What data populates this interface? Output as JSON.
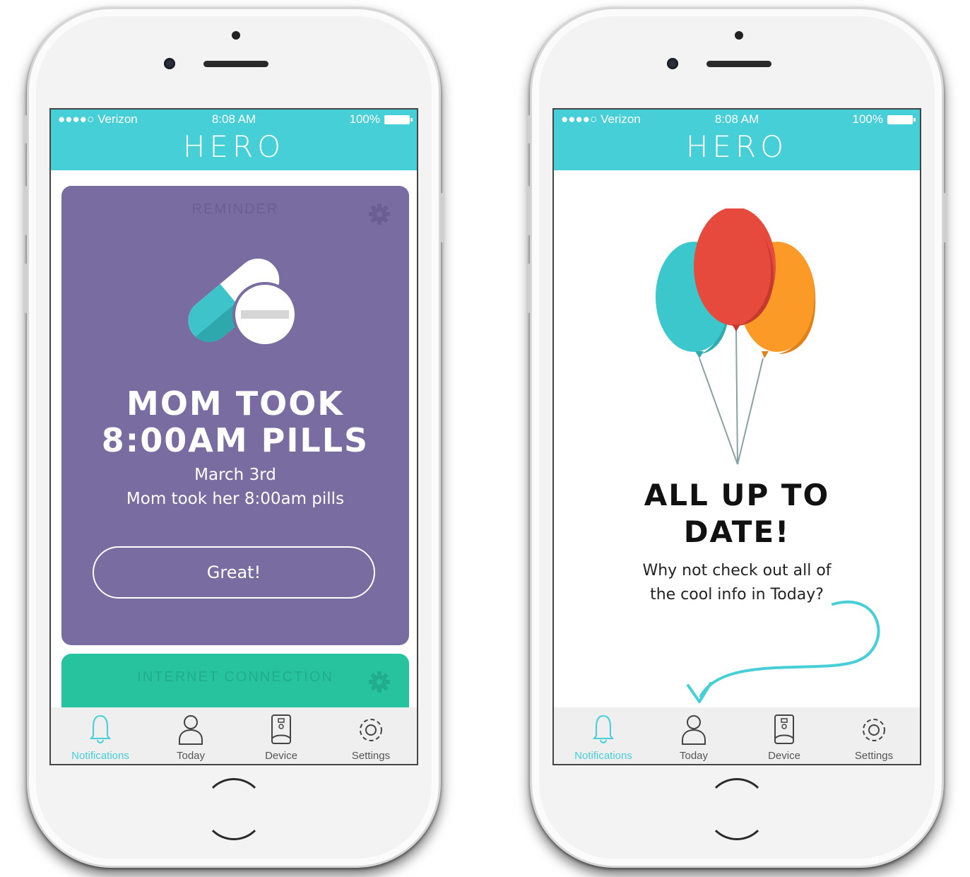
{
  "status_bar": {
    "carrier": "●●●●○ Verizon",
    "time": "8:08 AM",
    "battery": "100%"
  },
  "app": {
    "title": "HERO",
    "accent_color": "#46cfd6"
  },
  "left_screen": {
    "reminder_card": {
      "label": "REMINDER",
      "headline_line1": "MOM TOOK",
      "headline_line2": "8:00AM PILLS",
      "date": "March 3rd",
      "body": "Mom took her 8:00am pills",
      "button": "Great!",
      "color": "#786ca0"
    },
    "internet_card": {
      "label": "INTERNET CONNECTION",
      "color": "#27c39f"
    }
  },
  "right_screen": {
    "headline_line1": "ALL UP TO",
    "headline_line2": "DATE!",
    "body_line1": "Why not check out all of",
    "body_line2": "the cool info in Today?"
  },
  "tabs": [
    {
      "label": "Notifications",
      "icon": "bell-icon",
      "active": true
    },
    {
      "label": "Today",
      "icon": "person-icon",
      "active": false
    },
    {
      "label": "Device",
      "icon": "device-icon",
      "active": false
    },
    {
      "label": "Settings",
      "icon": "gear-icon",
      "active": false
    }
  ]
}
